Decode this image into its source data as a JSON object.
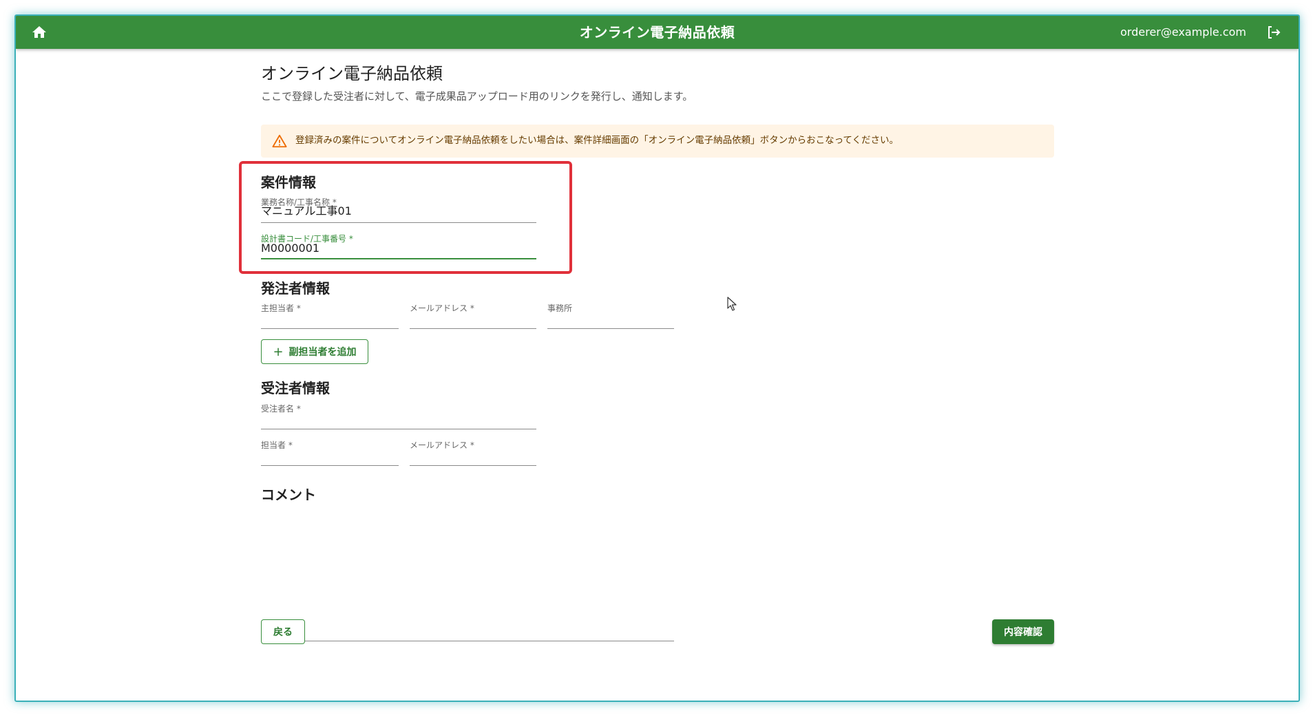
{
  "header": {
    "title": "オンライン電子納品依頼",
    "user_email": "orderer@example.com",
    "home_icon": "home-icon",
    "logout_icon": "logout-icon",
    "color": "#388e3c"
  },
  "page": {
    "title": "オンライン電子納品依頼",
    "description": "ここで登録した受注者に対して、電子成果品アップロード用のリンクを発行し、通知します。"
  },
  "alert": {
    "icon": "warning-icon",
    "text": "登録済みの案件についてオンライン電子納品依頼をしたい場合は、案件詳細画面の「オンライン電子納品依頼」ボタンからおこなってください。",
    "background": "#fff4e5"
  },
  "case_info": {
    "title": "案件情報",
    "business_name_label": "業務名称/工事名称 *",
    "business_name_value": "マニュアル工事01",
    "design_code_label": "設計書コード/工事番号 *",
    "design_code_value": "M0000001"
  },
  "orderer_info": {
    "title": "発注者情報",
    "main_person_label": "主担当者 *",
    "main_person_value": "",
    "email_label": "メールアドレス *",
    "email_value": "",
    "office_label": "事務所",
    "office_value": "",
    "add_sub_button": "副担当者を追加"
  },
  "contractor_info": {
    "title": "受注者情報",
    "contractor_name_label": "受注者名 *",
    "contractor_name_value": "",
    "person_label": "担当者 *",
    "person_value": "",
    "email_label": "メールアドレス *",
    "email_value": ""
  },
  "comment": {
    "title": "コメント",
    "value": ""
  },
  "actions": {
    "back_label": "戻る",
    "confirm_label": "内容確認"
  },
  "colors": {
    "primary": "#388e3c",
    "highlight": "#e0303a",
    "window_border": "#3ab0b8"
  }
}
